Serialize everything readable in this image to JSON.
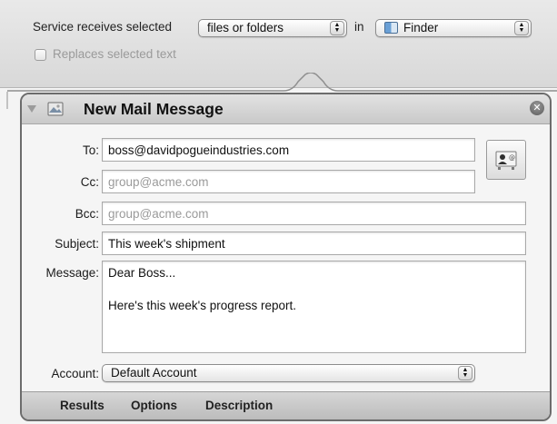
{
  "service": {
    "prefix": "Service receives selected",
    "input_type": "files or folders",
    "in_label": "in",
    "application": "Finder",
    "replaces_label": "Replaces selected text"
  },
  "action": {
    "title": "New Mail Message",
    "fields": {
      "to_label": "To:",
      "to_value": "boss@davidpogueindustries.com",
      "cc_label": "Cc:",
      "cc_placeholder": "group@acme.com",
      "bcc_label": "Bcc:",
      "bcc_placeholder": "group@acme.com",
      "subject_label": "Subject:",
      "subject_value": "This week's shipment",
      "message_label": "Message:",
      "message_value": "Dear Boss...\n\nHere's this week's progress report.",
      "account_label": "Account:",
      "account_value": "Default Account"
    },
    "footer": {
      "results": "Results",
      "options": "Options",
      "description": "Description"
    }
  },
  "icons": {
    "popup_arrows": "updown-arrows-icon",
    "finder": "finder-icon",
    "mail": "mail-stamp-icon",
    "close": "close-icon",
    "address": "address-book-icon",
    "disclosure": "disclosure-triangle-icon"
  }
}
